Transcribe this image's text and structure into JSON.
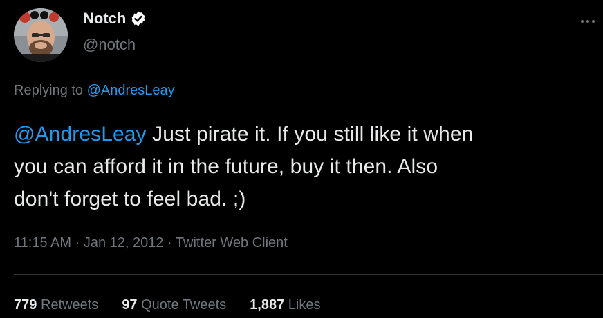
{
  "author": {
    "name": "Notch",
    "handle": "@notch",
    "verified": true,
    "avatar_icon": "profile-photo"
  },
  "reply": {
    "prefix": "Replying to",
    "handle": "@AndresLeay"
  },
  "tweet": {
    "mention": "@AndresLeay",
    "line1_rest": "Just pirate it. If you still like it when",
    "line2": "you can afford it in the future, buy it then. Also",
    "line3": "don't forget to feel bad. ;)"
  },
  "meta": {
    "time": "11:15 AM",
    "date": "Jan 12, 2012",
    "client": "Twitter Web Client",
    "separator": "·"
  },
  "stats": {
    "retweets": {
      "count": "779",
      "label": "Retweets"
    },
    "quotes": {
      "count": "97",
      "label": "Quote Tweets"
    },
    "likes": {
      "count": "1,887",
      "label": "Likes"
    }
  },
  "colors": {
    "background": "#000000",
    "text": "#e7e9ea",
    "secondary": "#71767b",
    "link": "#1d9bf0"
  }
}
